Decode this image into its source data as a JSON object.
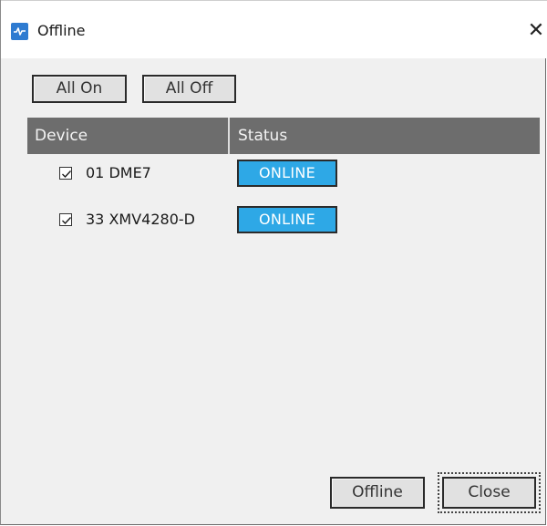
{
  "window": {
    "title": "Offline",
    "close_glyph": "✕",
    "app_icon": "app-logo-icon"
  },
  "toolbar": {
    "all_on_label": "All On",
    "all_off_label": "All Off"
  },
  "table": {
    "columns": [
      "Device",
      "Status"
    ],
    "rows": [
      {
        "checked": true,
        "device": "01 DME7",
        "status": "ONLINE"
      },
      {
        "checked": true,
        "device": "33 XMV4280-D",
        "status": "ONLINE"
      }
    ]
  },
  "footer": {
    "offline_label": "Offline",
    "close_label": "Close"
  },
  "colors": {
    "status_online": "#2ea8e6",
    "header_bg": "#6d6d6d",
    "accent": "#2e7bd1"
  }
}
